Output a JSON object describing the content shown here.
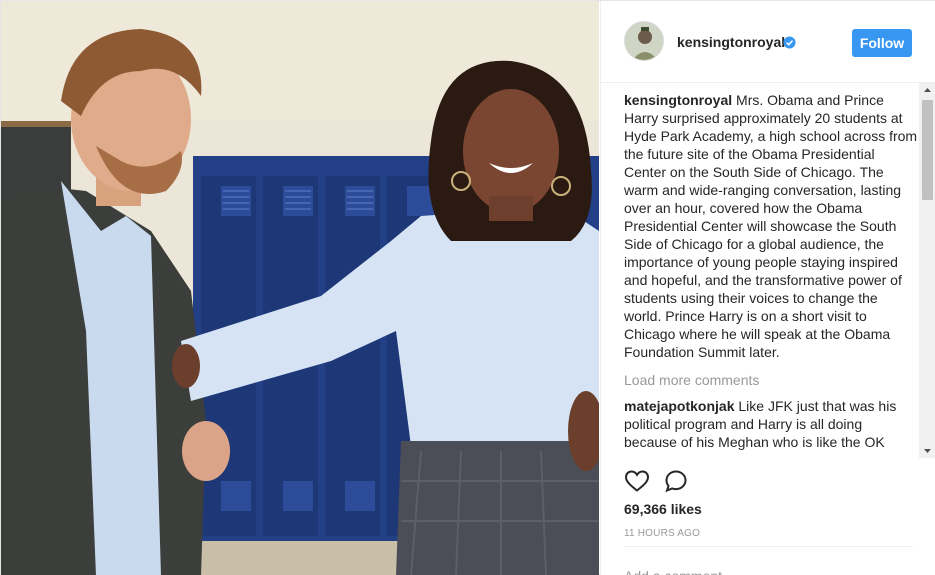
{
  "post": {
    "account": {
      "username": "kensingtonroyal",
      "verified": true,
      "avatar_icon": "profile-photo",
      "follow_label": "Follow"
    },
    "caption": {
      "author": "kensingtonroyal",
      "text": "Mrs. Obama and Prince Harry surprised approximately 20 students at Hyde Park Academy, a high school across from the future site of the Obama Presidential Center on the South Side of Chicago. The warm and wide-ranging conversation, lasting over an hour, covered how the Obama Presidential Center will showcase the South Side of Chicago for a global audience, the importance of young people staying inspired and hopeful, and the transformative power of students using their voices to change the world. Prince Harry is on a short visit to Chicago where he will speak at the Obama Foundation Summit later."
    },
    "load_more_label": "Load more comments",
    "comments": [
      {
        "author": "matejapotkonjak",
        "text": "Like JFK just that was his political program and Harry is all doing because of his Meghan who is like the OK"
      }
    ],
    "actions": {
      "like_icon": "heart-outline-icon",
      "comment_icon": "speech-bubble-icon"
    },
    "likes_text": "69,366 likes",
    "timestamp": "11 HOURS AGO",
    "add_comment_placeholder": "Add a comment..."
  },
  "colors": {
    "follow_button": "#3897f0",
    "verified_badge": "#3897f0",
    "text_primary": "#262626",
    "text_secondary": "#999999",
    "border": "#efefef"
  }
}
